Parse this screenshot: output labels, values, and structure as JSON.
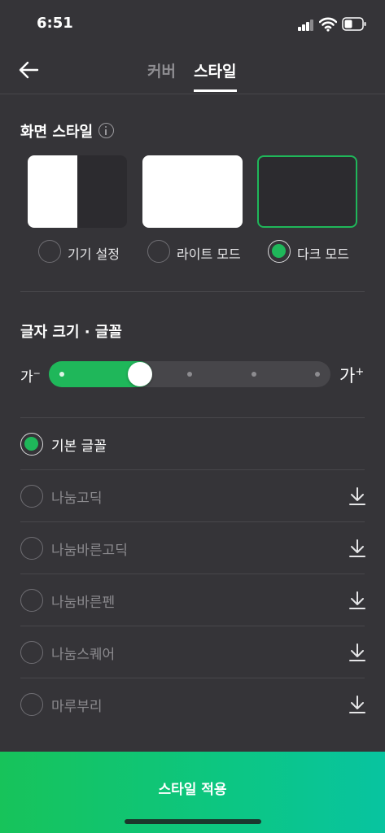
{
  "status_bar": {
    "time": "6:51"
  },
  "header": {
    "tabs": [
      {
        "label": "커버",
        "active": false
      },
      {
        "label": "스타일",
        "active": true
      }
    ]
  },
  "screen_style": {
    "title": "화면 스타일",
    "options": [
      {
        "label": "기기 설정",
        "selected": false
      },
      {
        "label": "라이트 모드",
        "selected": false
      },
      {
        "label": "다크 모드",
        "selected": true
      }
    ]
  },
  "font_size": {
    "title": "글자 크기 · 글꼴",
    "small_label": "가",
    "large_label": "가",
    "level": 2,
    "levels": 5
  },
  "fonts": [
    {
      "name": "기본 글꼴",
      "selected": true,
      "downloadable": false
    },
    {
      "name": "나눔고딕",
      "selected": false,
      "downloadable": true
    },
    {
      "name": "나눔바른고딕",
      "selected": false,
      "downloadable": true
    },
    {
      "name": "나눔바른펜",
      "selected": false,
      "downloadable": true
    },
    {
      "name": "나눔스퀘어",
      "selected": false,
      "downloadable": true
    },
    {
      "name": "마루부리",
      "selected": false,
      "downloadable": true
    }
  ],
  "apply_button": {
    "label": "스타일 적용"
  },
  "colors": {
    "background": "#353438",
    "accent": "#1fb75a",
    "button_gradient_end": "#08c4a0"
  }
}
